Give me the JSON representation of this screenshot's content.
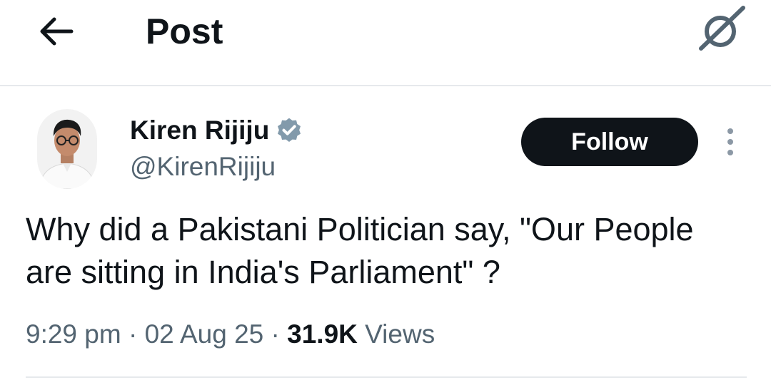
{
  "header": {
    "title": "Post",
    "back_icon": "arrow-left-icon",
    "grok_icon": "grok-icon"
  },
  "post": {
    "author_name": "Kiren Rijiju",
    "author_handle": "@KirenRijiju",
    "verified": true,
    "verified_color": "#829aab",
    "follow_label": "Follow",
    "text": "Why did a Pakistani Politician say, \"Our People are sitting in  India's Parliament\" ?",
    "time": "9:29 pm",
    "separator": "·",
    "date": "02 Aug 25",
    "views_count": "31.9K",
    "views_label": "Views"
  }
}
